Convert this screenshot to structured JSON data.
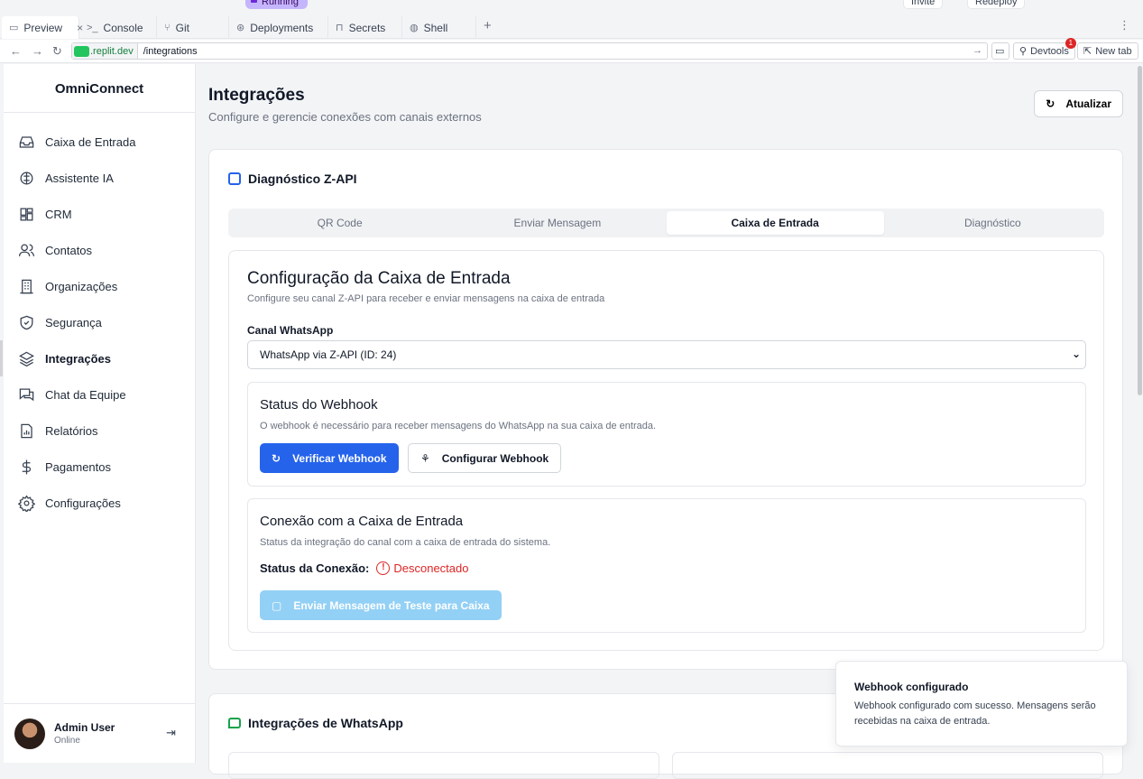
{
  "browser": {
    "top_status": "Running",
    "top_pills": [
      "Invite",
      "Redeploy"
    ],
    "tabs": [
      {
        "label": "Preview",
        "icon": "monitor-icon",
        "active": true
      },
      {
        "label": "Console",
        "icon": "terminal-icon"
      },
      {
        "label": "Git",
        "icon": "git-icon"
      },
      {
        "label": "Deployments",
        "icon": "deploy-icon"
      },
      {
        "label": "Secrets",
        "icon": "lock-icon"
      },
      {
        "label": "Shell",
        "icon": "shell-icon"
      }
    ],
    "tab_close": "×",
    "add_tab": "+",
    "url_host": ".replit.dev",
    "url_path": "/integrations",
    "devtools_label": "Devtools",
    "devtools_badge": "1",
    "new_tab_label": "New tab"
  },
  "sidebar": {
    "brand": "OmniConnect",
    "items": [
      {
        "label": "Caixa de Entrada",
        "icon": "inbox-icon"
      },
      {
        "label": "Assistente IA",
        "icon": "brain-icon"
      },
      {
        "label": "CRM",
        "icon": "grid-icon"
      },
      {
        "label": "Contatos",
        "icon": "users-icon"
      },
      {
        "label": "Organizações",
        "icon": "building-icon"
      },
      {
        "label": "Segurança",
        "icon": "shield-icon"
      },
      {
        "label": "Integrações",
        "icon": "layers-icon",
        "active": true
      },
      {
        "label": "Chat da Equipe",
        "icon": "chat-icon"
      },
      {
        "label": "Relatórios",
        "icon": "report-icon"
      },
      {
        "label": "Pagamentos",
        "icon": "dollar-icon"
      },
      {
        "label": "Configurações",
        "icon": "gear-icon"
      }
    ],
    "user": {
      "name": "Admin User",
      "status": "Online"
    }
  },
  "header": {
    "title": "Integrações",
    "subtitle": "Configure e gerencie conexões com canais externos",
    "refresh_label": "Atualizar"
  },
  "diagnostic": {
    "title": "Diagnóstico Z-API",
    "tabs": [
      "QR Code",
      "Enviar Mensagem",
      "Caixa de Entrada",
      "Diagnóstico"
    ],
    "active_tab": "Caixa de Entrada",
    "inbox": {
      "title": "Configuração da Caixa de Entrada",
      "description": "Configure seu canal Z-API para receber e enviar mensagens na caixa de entrada",
      "channel_label": "Canal WhatsApp",
      "channel_value": "WhatsApp via Z-API (ID: 24)",
      "webhook": {
        "title": "Status do Webhook",
        "description": "O webhook é necessário para receber mensagens do WhatsApp na sua caixa de entrada.",
        "verify_label": "Verificar Webhook",
        "configure_label": "Configurar Webhook"
      },
      "connection": {
        "title": "Conexão com a Caixa de Entrada",
        "description": "Status da integração do canal com a caixa de entrada do sistema.",
        "status_label": "Status da Conexão:",
        "status_value": "Desconectado",
        "test_label": "Enviar Mensagem de Teste para Caixa"
      }
    }
  },
  "whatsapp": {
    "title": "Integrações de WhatsApp"
  },
  "toast": {
    "title": "Webhook configurado",
    "description": "Webhook configurado com sucesso. Mensagens serão recebidas na caixa de entrada."
  },
  "colors": {
    "primary": "#2563eb",
    "danger": "#dc2626",
    "disabled": "#93d0f5"
  }
}
